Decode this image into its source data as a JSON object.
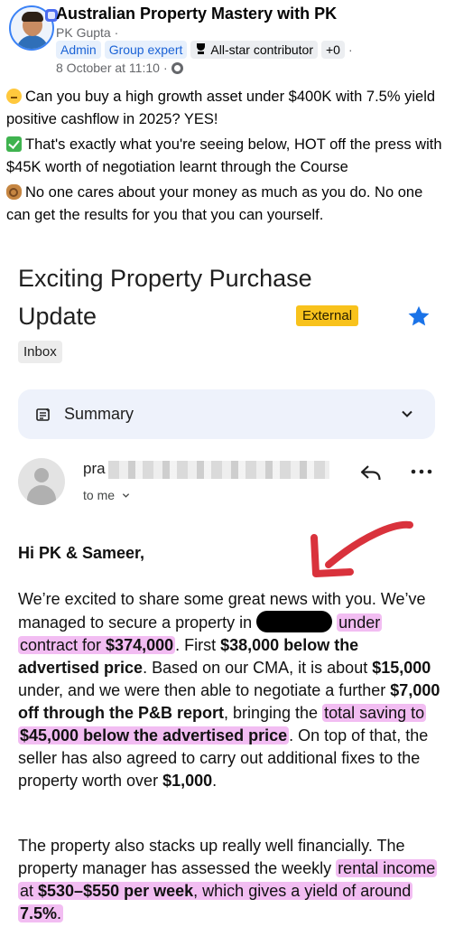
{
  "post": {
    "group_name": "Australian Property Mastery with PK",
    "author": "PK Gupta",
    "author_sep": "·",
    "badges": {
      "admin": "Admin",
      "group_expert": "Group expert",
      "all_star": "All-star contributor",
      "more": "+0"
    },
    "timestamp": "8 October at 11:10",
    "timestamp_sep": "·",
    "paragraphs": [
      "Can you buy a high growth asset under $400K with 7.5% yield positive cashflow in 2025? YES!",
      "That's exactly what you're seeing below, HOT off the press with $45K worth of negotiation learnt through the Course",
      "No one cares about your money as much as you do. No one can get the results for you that you can yourself."
    ],
    "emoji_icons": [
      "thinking-face-icon",
      "check-mark-icon",
      "ok-hand-icon"
    ]
  },
  "email": {
    "subject": "Exciting Property Purchase Update",
    "external_label": "External",
    "inbox_label": "Inbox",
    "summary_label": "Summary",
    "sender_prefix": "pra",
    "to_me": "to me",
    "greeting": "Hi PK & Sameer,",
    "para1": {
      "t1": "We’re excited to share some great news with you. We’ve managed to secure a property in ",
      "h1": "under contract for ",
      "b1": "$374,000",
      "t2": ". First ",
      "b2": "$38,000 below the advertised price",
      "t3": ". Based on our CMA, it is about ",
      "b3": "$15,000",
      "t4": " under, and we were then able to negotiate a further ",
      "b4": "$7,000 off through the P&B report",
      "t5": ", bringing the ",
      "h2": "total saving to ",
      "b5": "$45,000 below the advertised price",
      "t6": ". On top of that, the seller has also agreed to carry out additional fixes to the property worth over ",
      "b6": "$1,000",
      "t7": "."
    },
    "para2": {
      "t1": "The property also stacks up really well financially. The property manager has assessed the weekly ",
      "h1": "rental income at ",
      "b1": "$530–$550 per week",
      "h2": ", which gives a yield of around ",
      "b2": "7.5%",
      "h3": "."
    }
  },
  "colors": {
    "highlight": "#f2bdf2",
    "external_tag": "#f8c21c",
    "star": "#1a73e8",
    "arrow": "#d9323c",
    "badge_blue": "#1b63d6"
  }
}
